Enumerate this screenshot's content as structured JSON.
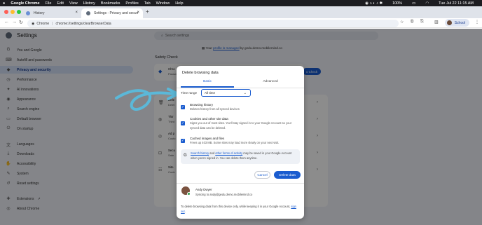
{
  "menubar": {
    "apple": "",
    "items": [
      "Google Chrome",
      "File",
      "Edit",
      "View",
      "History",
      "Bookmarks",
      "Profiles",
      "Tab",
      "Window",
      "Help"
    ],
    "battery": "100%",
    "clock": "Tue Jul 22  11:15 AM"
  },
  "tabs": [
    {
      "label": "History"
    },
    {
      "label": "Settings - Privacy and securi"
    }
  ],
  "address": {
    "chip": "Chrome",
    "url": "chrome://settings/clearBrowserData"
  },
  "profile": {
    "label": "School"
  },
  "settings": {
    "title": "Settings",
    "search_placeholder": "Search settings",
    "managed_prefix": "Your ",
    "managed_link": "profile is managed",
    "managed_suffix": " by gedu.demo.mobilemind.co",
    "safety_check": "Safety Check",
    "safety_btn": "o Check",
    "sidebar": [
      {
        "icon": "G",
        "label": "You and Google"
      },
      {
        "icon": "⌨",
        "label": "Autofill and passwords"
      },
      {
        "icon": "◆",
        "label": "Privacy and security"
      },
      {
        "icon": "◷",
        "label": "Performance"
      },
      {
        "icon": "✦",
        "label": "AI innovations"
      },
      {
        "icon": "◉",
        "label": "Appearance"
      },
      {
        "icon": "⌕",
        "label": "Search engine"
      },
      {
        "icon": "▭",
        "label": "Default browser"
      },
      {
        "icon": "⏻",
        "label": "On startup"
      },
      {
        "icon": "文",
        "label": "Languages"
      },
      {
        "icon": "⤓",
        "label": "Downloads"
      },
      {
        "icon": "✋",
        "label": "Accessibility"
      },
      {
        "icon": "✎",
        "label": "System"
      },
      {
        "icon": "↺",
        "label": "Reset settings"
      },
      {
        "icon": "✚",
        "label": "Extensions"
      },
      {
        "icon": "◎",
        "label": "About Chrome"
      }
    ],
    "rows": [
      {
        "a": "Chro",
        "b": "Passw"
      },
      {
        "a": "Dele",
        "b": "Delet"
      },
      {
        "a": "Thir",
        "b": "Third"
      },
      {
        "a": "Ad p",
        "b": "Custo"
      },
      {
        "a": "Secu",
        "b": "Safe"
      },
      {
        "a": "Site",
        "b": "Contr"
      }
    ]
  },
  "dialog": {
    "title": "Delete browsing data",
    "tab_basic": "Basic",
    "tab_advanced": "Advanced",
    "time_range_label": "Time range",
    "time_range_value": "All time",
    "items": [
      {
        "title": "Browsing history",
        "desc": "Deletes history from all synced devices",
        "checked": true
      },
      {
        "title": "Cookies and other site data",
        "desc": "Signs you out of most sites. You'll stay signed in to your Google Account so your synced data can be deleted.",
        "checked": true
      },
      {
        "title": "Cached images and files",
        "desc": "Frees up 403 MB. Some sites may load more slowly on your next visit.",
        "checked": true
      }
    ],
    "google_note": {
      "link1": "Search history",
      "mid": " and ",
      "link2": "other forms of activity",
      "rest": " may be saved in your Google Account when you're signed in. You can delete them anytime."
    },
    "cancel_label": "Cancel",
    "delete_label": "Delete data",
    "user_name": "Andy Dwyer",
    "user_sync": "Syncing to andy@gedu.demo.mobilemind.co",
    "footer_text": "To delete browsing data from this device only, while keeping it in your Google Account, ",
    "footer_link": "sign out",
    "footer_end": "."
  },
  "colors": {
    "accent": "#1a5ccf",
    "arrow": "#5bb8d8"
  }
}
